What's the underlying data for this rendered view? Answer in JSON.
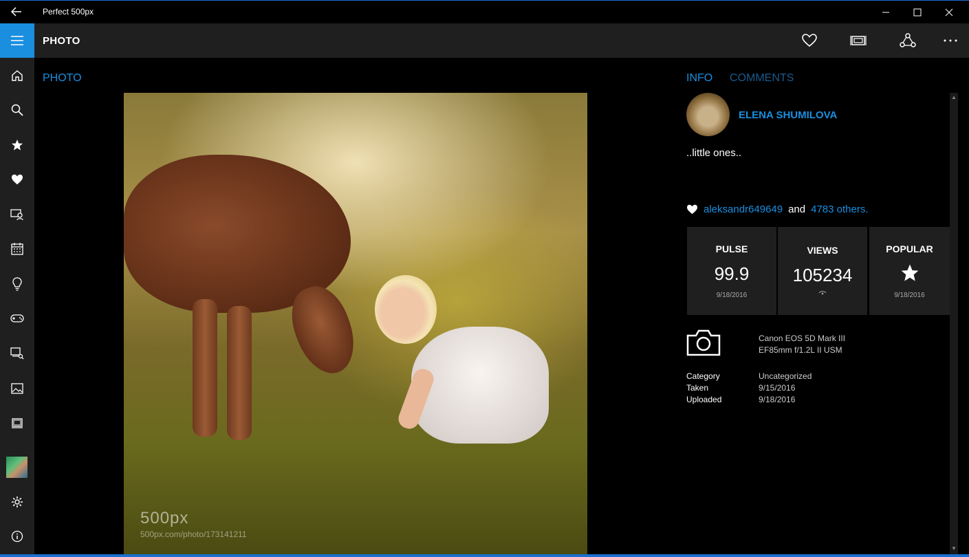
{
  "window": {
    "title": "Perfect 500px"
  },
  "appbar": {
    "page_title": "PHOTO"
  },
  "main": {
    "section_label": "PHOTO",
    "photo": {
      "watermark_logo": "500px",
      "watermark_url": "500px.com/photo/173141211"
    }
  },
  "info": {
    "tabs": [
      "INFO",
      "COMMENTS"
    ],
    "author_name": "ELENA SHUMILOVA",
    "caption": "..little ones..",
    "likes": {
      "user": "aleksandr649649",
      "and": "and",
      "others": "4783 others."
    },
    "stats": [
      {
        "label": "PULSE",
        "value": "99.9",
        "sub": "9/18/2016"
      },
      {
        "label": "VIEWS",
        "value": "105234",
        "sub": ""
      },
      {
        "label": "POPULAR",
        "value": "",
        "sub": "9/18/2016"
      }
    ],
    "camera": {
      "model": "Canon EOS 5D Mark III",
      "lens": "EF85mm f/1.2L II USM"
    },
    "meta": {
      "keys": [
        "Category",
        "Taken",
        "Uploaded"
      ],
      "values": [
        "Uncategorized",
        "9/15/2016",
        "9/18/2016"
      ]
    }
  },
  "colors": {
    "accent": "#1a8fe0",
    "panel": "#1f1f1f",
    "background": "#000000"
  }
}
